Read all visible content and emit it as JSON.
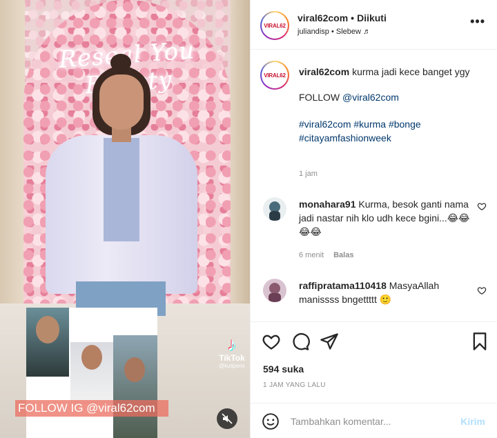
{
  "header": {
    "username": "viral62com",
    "separator": "•",
    "follow_status": "Diikuti",
    "sub_user": "juliandisp",
    "sub_separator": "•",
    "audio": "Slebew ♬",
    "more": "•••",
    "avatar_logo": "VIRAL62"
  },
  "media": {
    "neon_sign": "Reseal You Beauty",
    "follow_banner": "FOLLOW IG @viral62com",
    "tiktok_label": "TikTok",
    "tiktok_handle": "@kutipenx"
  },
  "caption": {
    "username": "viral62com",
    "text_line1": "kurma jadi kece banget ygy",
    "follow_prefix": "FOLLOW ",
    "follow_mention": "@viral62com",
    "hashtags_line1": "#viral62com #kurma #bonge",
    "hashtags_line2": "#citayamfashionweek",
    "time": "1 jam"
  },
  "comments": [
    {
      "username": "monahara91",
      "text": "Kurma, besok ganti nama jadi nastar nih klo udh kece bgini...😂😂😂😂",
      "time": "6 menit",
      "reply_label": "Balas"
    },
    {
      "username": "raffipratama110418",
      "text": "MasyaAllah manissss bngettttt 🙂",
      "time": "",
      "reply_label": ""
    }
  ],
  "actions": {
    "likes": "594 suka",
    "time_ago": "1 JAM YANG LALU"
  },
  "add_comment": {
    "placeholder": "Tambahkan komentar...",
    "post_label": "Kirim"
  },
  "colors": {
    "link": "#00376b",
    "muted": "#8e8e8e",
    "post_button_disabled": "#b2dffc"
  }
}
